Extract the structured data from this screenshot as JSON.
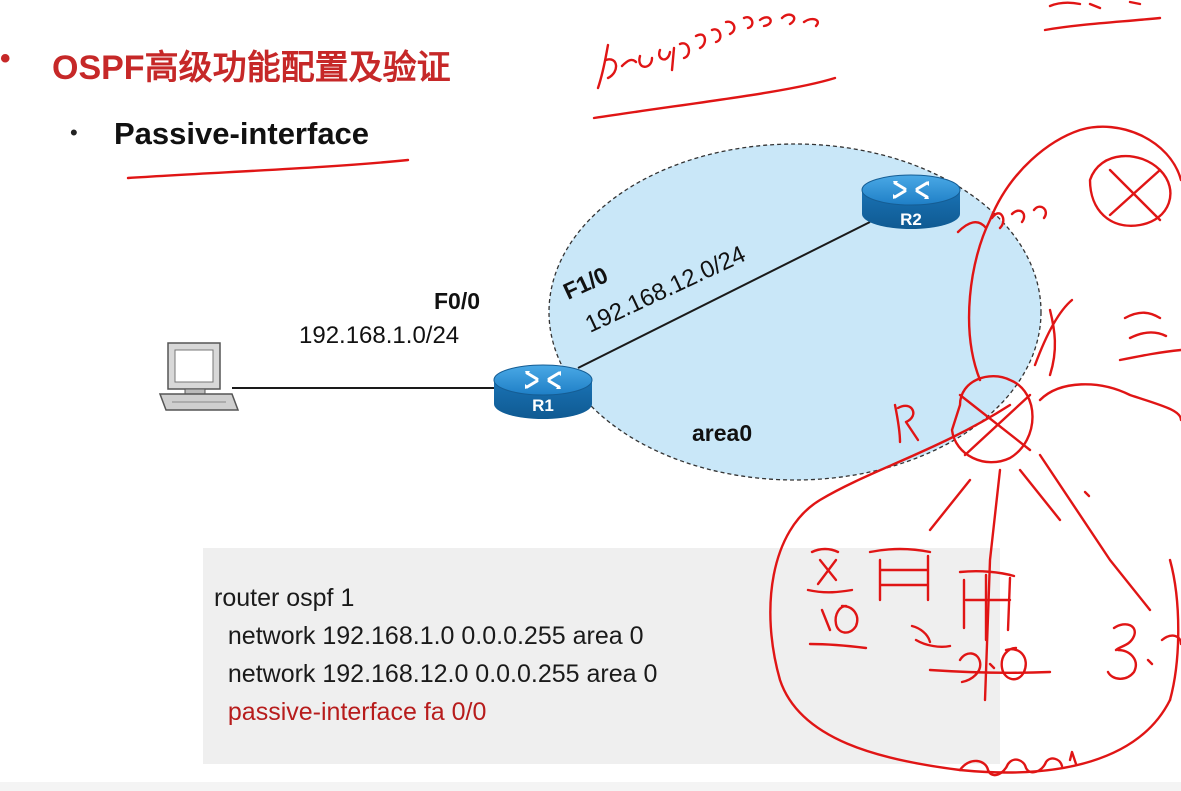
{
  "slide": {
    "title": "OSPF高级功能配置及验证",
    "subtitle": "Passive-interface",
    "bullet": "•"
  },
  "diagram": {
    "r1_label": "R1",
    "r2_label": "R2",
    "f00_label": "F0/0",
    "lan_net": "192.168.1.0/24",
    "f10_label": "F1/0",
    "link_net": "192.168.12.0/24",
    "area_label": "area0"
  },
  "code": {
    "lines": [
      "router ospf 1",
      "  network 192.168.1.0 0.0.0.255 area 0",
      "  network 192.168.12.0 0.0.0.255 area 0",
      "  passive-interface fa 0/0"
    ]
  },
  "colors": {
    "title_red": "#c62828",
    "area_fill": "#c9e7f8",
    "router_blue": "#1d7fc4",
    "ink_red": "#e01515",
    "code_highlight": "#b71c1c"
  }
}
